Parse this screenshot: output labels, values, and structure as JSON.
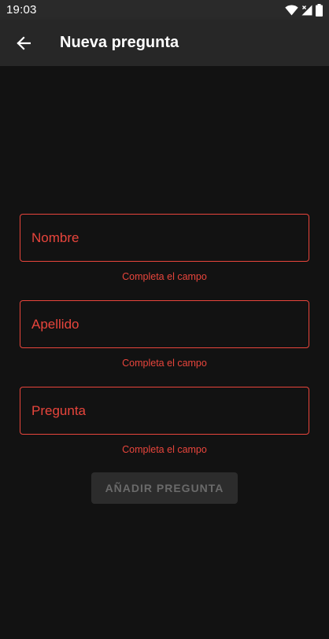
{
  "status_bar": {
    "time": "19:03",
    "icons": [
      "wifi-icon",
      "signal-icon",
      "battery-icon"
    ]
  },
  "app_bar": {
    "back_icon": "arrow-back-icon",
    "title": "Nueva pregunta"
  },
  "form": {
    "fields": [
      {
        "placeholder": "Nombre",
        "value": "",
        "helper": "Completa el campo"
      },
      {
        "placeholder": "Apellido",
        "value": "",
        "helper": "Completa el campo"
      },
      {
        "placeholder": "Pregunta",
        "value": "",
        "helper": "Completa el campo"
      }
    ],
    "submit_label": "AÑADIR PREGUNTA",
    "submit_enabled": false
  },
  "colors": {
    "background": "#121212",
    "app_bar": "#272727",
    "status_bar": "#2a2a2a",
    "error": "#e8453c",
    "button_disabled_bg": "#2c2c2c",
    "button_disabled_text": "#6a6a6a"
  }
}
